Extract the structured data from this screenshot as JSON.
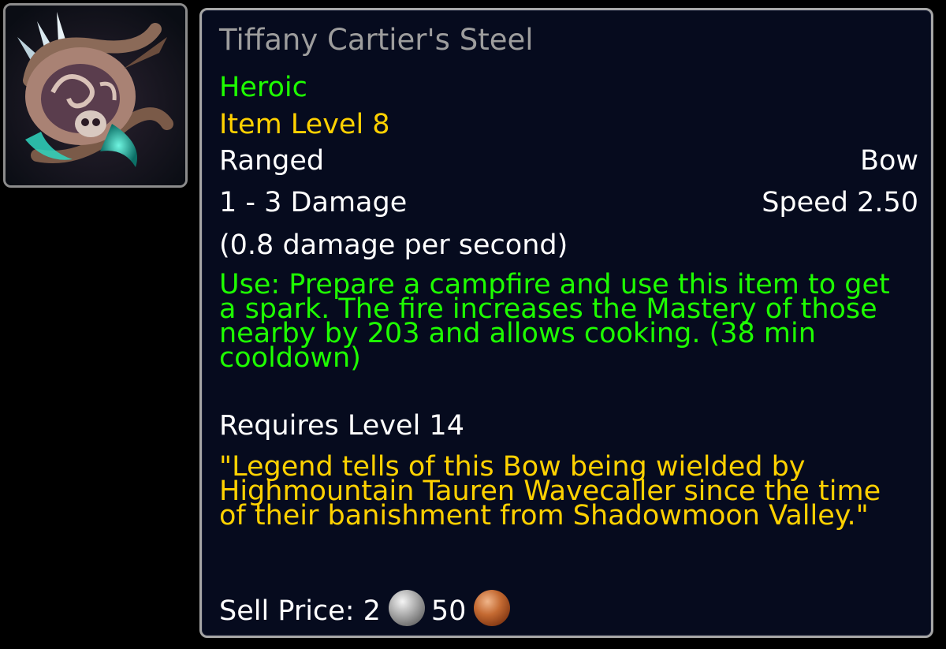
{
  "icon": {
    "name": "bow-item-icon",
    "colors": {
      "frame": "#8c8c8c",
      "glow": "#2fd6c0",
      "skull": "#d8c8c0"
    }
  },
  "tooltip": {
    "title": "Tiffany Cartier's Steel",
    "difficulty": "Heroic",
    "item_level": "Item Level 8",
    "slot": "Ranged",
    "weapon_type": "Bow",
    "damage": "1 - 3 Damage",
    "speed": "Speed 2.50",
    "dps": "(0.8 damage per second)",
    "use_text": "Use: Prepare a campfire and use this item to get a spark. The fire increases the Mastery of those nearby by 203 and allows cooking. (38 min cooldown)",
    "requirement": "Requires Level 14",
    "flavor_text": "\"Legend tells of this Bow being wielded by Highmountain Tauren Wavecaller since the time of their banishment from Shadowmoon Valley.\"",
    "sell_label": "Sell Price: 2",
    "sell_copper": "50"
  },
  "colors": {
    "title": "#9d9d9d",
    "green": "#1eff00",
    "gold": "#ffd100",
    "white": "#ffffff",
    "background": "#060b1e",
    "border": "#a6a6a6"
  }
}
